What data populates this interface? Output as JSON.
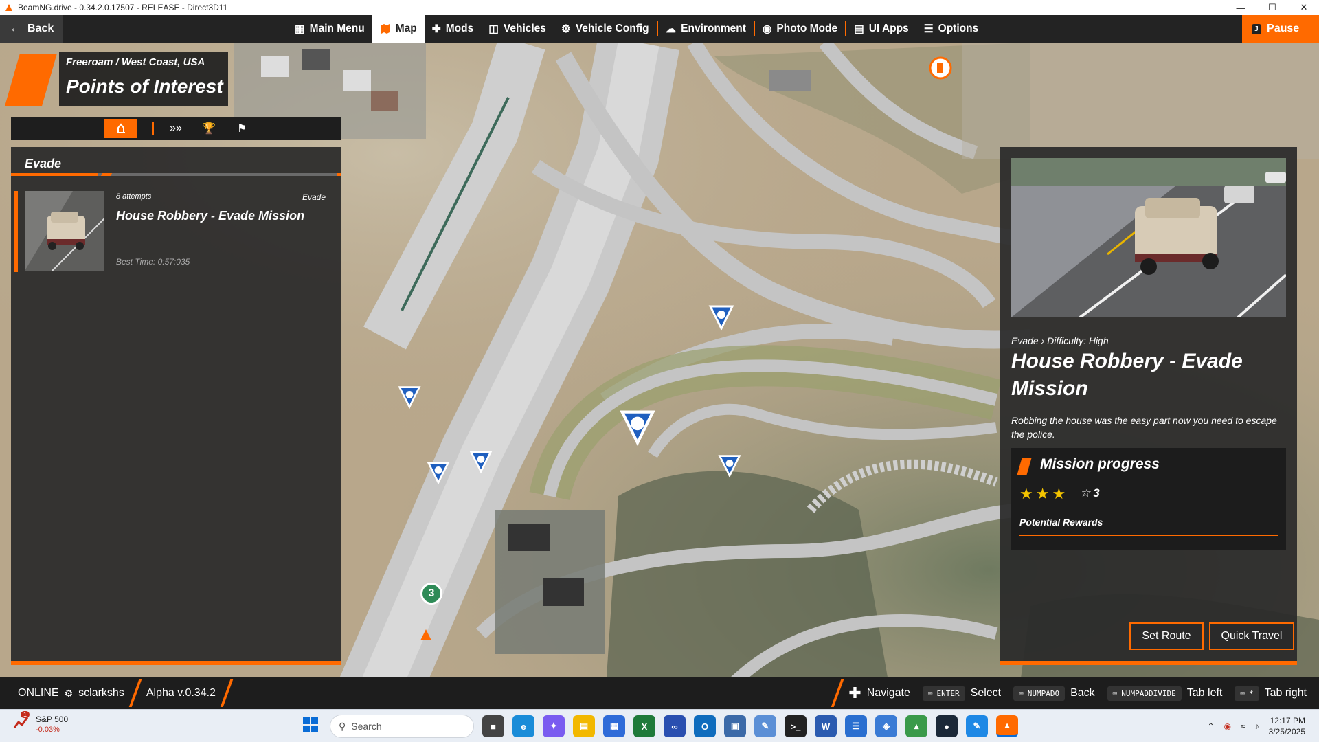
{
  "window": {
    "title": "BeamNG.drive - 0.34.2.0.17507 - RELEASE - Direct3D11"
  },
  "topbar": {
    "back_label": "Back",
    "nav": [
      {
        "label": "Main Menu",
        "icon": "grid-icon"
      },
      {
        "label": "Map",
        "icon": "map-icon",
        "active": true
      },
      {
        "label": "Mods",
        "icon": "puzzle-icon"
      },
      {
        "label": "Vehicles",
        "icon": "car-icon"
      },
      {
        "label": "Vehicle Config",
        "icon": "car-config-icon"
      },
      {
        "label": "Environment",
        "icon": "weather-icon"
      },
      {
        "label": "Photo Mode",
        "icon": "camera-icon"
      },
      {
        "label": "UI Apps",
        "icon": "apps-icon"
      },
      {
        "label": "Options",
        "icon": "sliders-icon"
      }
    ],
    "pause_key": "J",
    "pause_label": "Pause"
  },
  "header": {
    "breadcrumb": "Freeroam / West Coast, USA",
    "title": "Points of Interest"
  },
  "tabs": [
    {
      "icon": "mission-icon",
      "active": true
    },
    {
      "icon": "chevrons-icon"
    },
    {
      "icon": "trophy-icon"
    },
    {
      "icon": "route-flag-icon"
    }
  ],
  "list": {
    "section_title": "Evade",
    "items": [
      {
        "attempts": "8 attempts",
        "type": "Evade",
        "title": "House Robbery - Evade Mission",
        "best_time": "Best Time: 0:57:035"
      }
    ]
  },
  "map_markers": [
    {
      "label": "3",
      "kind": "waypoint-number"
    }
  ],
  "detail": {
    "meta_type": "Evade",
    "meta_sep": "›",
    "meta_difficulty": "Difficulty: High",
    "title": "House Robbery - Evade Mission",
    "description": "Robbing the house was the easy part now you need to escape the police.",
    "progress_title": "Mission progress",
    "stars_earned": 3,
    "stars_total_label": "3",
    "rewards_label": "Potential Rewards",
    "set_route_label": "Set Route",
    "quick_travel_label": "Quick Travel"
  },
  "status": {
    "online": "ONLINE",
    "user": "sclarkshs",
    "version": "Alpha v.0.34.2",
    "hints": [
      {
        "key": "",
        "label": "Navigate",
        "icon": "dpad-icon"
      },
      {
        "key": "ENTER",
        "label": "Select"
      },
      {
        "key": "NUMPAD0",
        "label": "Back"
      },
      {
        "key": "NUMPADDIVIDE",
        "label": "Tab left"
      },
      {
        "key": "*",
        "label": "Tab right"
      }
    ]
  },
  "taskbar": {
    "stock_name": "S&P 500",
    "stock_change": "-0.03%",
    "stock_badge": "1",
    "search_placeholder": "Search",
    "time": "12:17 PM",
    "date": "3/25/2025"
  },
  "colors": {
    "accent": "#ff6a00",
    "panel": "#2a2a2a",
    "star": "#f4c400",
    "marker": "#1f5fbf"
  }
}
